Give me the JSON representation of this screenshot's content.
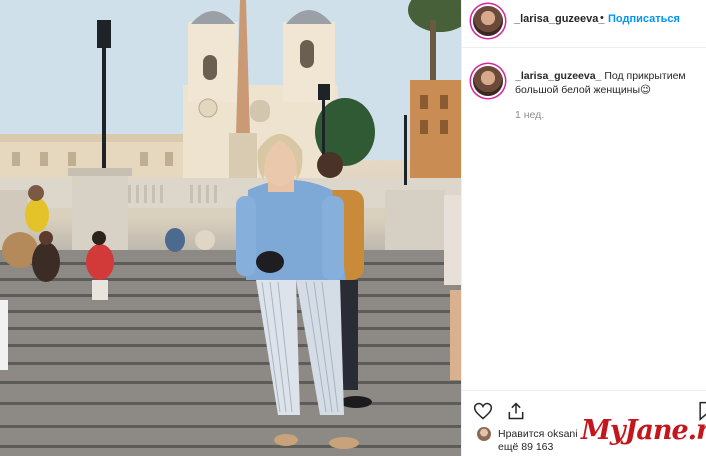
{
  "post": {
    "photo_alt": "Woman in blue shirt standing on the Spanish Steps in Rome",
    "author": {
      "username": "_larisa_guzeeva_",
      "separator": "•",
      "follow_label": "Подписаться",
      "more_icon": "more-horizontal-icon"
    },
    "caption": {
      "username": "_larisa_guzeeva_",
      "text": "Под прикрытием большой белой женщины😉",
      "time": "1 нед."
    },
    "actions": {
      "like_icon": "heart-icon",
      "share_icon": "share-icon",
      "save_icon": "bookmark-icon"
    },
    "likes": {
      "line1": "Нравится oksani",
      "line2": "ещё 89 163"
    }
  },
  "watermark": "MyJane.ru",
  "colors": {
    "follow": "#0095f6",
    "watermark": "#c4161c",
    "story_ring": "#d6249f"
  }
}
